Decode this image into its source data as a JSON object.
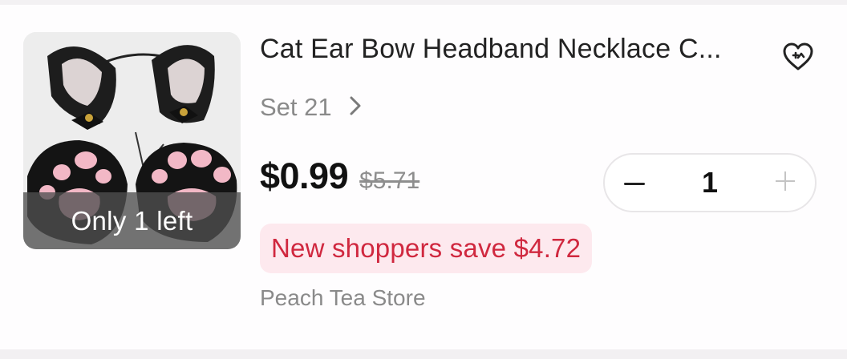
{
  "product": {
    "title": "Cat Ear Bow Headband Necklace C...",
    "stock_label": "Only 1 left",
    "variant": "Set 21",
    "price_current": "$0.99",
    "price_original": "$5.71",
    "promo": "New shoppers save $4.72",
    "store": "Peach Tea Store"
  },
  "quantity": {
    "value": "1"
  },
  "icons": {
    "wishlist": "heart-plus-icon",
    "variant_chevron": "chevron-right-icon",
    "decrease": "minus-icon",
    "increase": "plus-icon"
  },
  "colors": {
    "promo_text": "#d0283f",
    "promo_bg": "#fde9ee",
    "price": "#111111",
    "muted": "#8a8a8a"
  }
}
